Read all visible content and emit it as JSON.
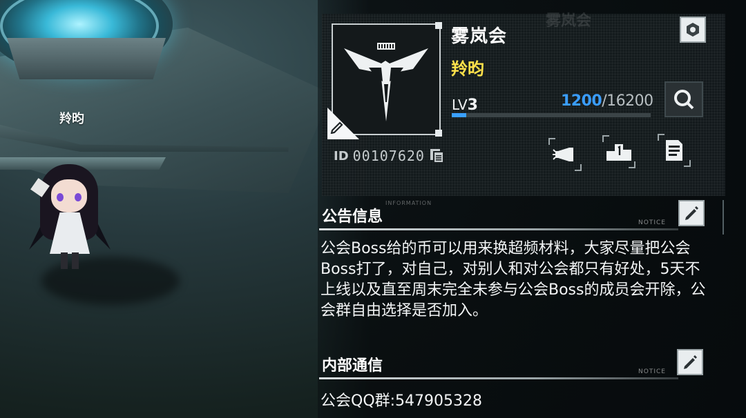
{
  "guild": {
    "name": "雾岚会",
    "leader": "羚昀",
    "level_prefix": "LV",
    "level": "3",
    "exp_current": "1200",
    "exp_max": "/16200",
    "exp_progress": 0.074,
    "id_label": "ID",
    "id_value": "00107620"
  },
  "scene": {
    "player_name": "羚昀"
  },
  "notice": {
    "title": "公告信息",
    "tag": "NOTICE",
    "subtitle": "INFORMATION",
    "body": "公会Boss给的币可以用来换超频材料，大家尽量把公会Boss打了，对自己，对别人和对公会都只有好处，5天不上线以及直至周末完全未参与公会Boss的成员会开除，公会群自由选择是否加入。"
  },
  "internal": {
    "title": "内部通信",
    "tag": "NOTICE",
    "body": "公会QQ群:547905328"
  },
  "icons": {
    "settings": "hexagon-nut-icon",
    "search": "search-icon",
    "copy": "copy-icon",
    "megaphone": "megaphone-icon",
    "ranking": "podium-icon",
    "log": "document-icon",
    "edit": "pencil-icon",
    "emblem": "winged-emblem-icon"
  },
  "colors": {
    "leader_name": "#ffe14a",
    "exp_accent": "#3a9dff",
    "panel_bg": "#161c1e"
  }
}
